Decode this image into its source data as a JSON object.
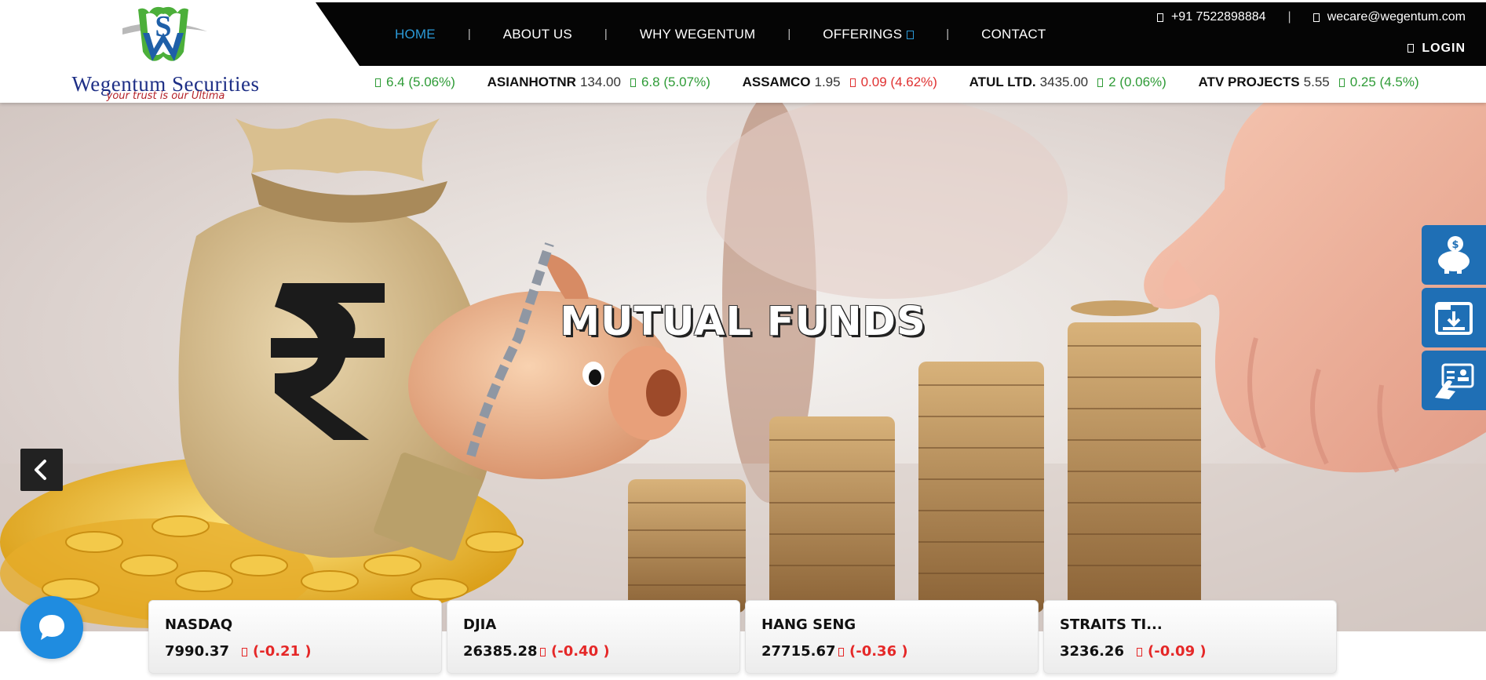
{
  "brand": {
    "name": "Wegentum Securities",
    "tagline": "your trust is our Ultima",
    "colors": {
      "navy": "#1e2f86",
      "accent": "#2b9ad8",
      "tagline": "#b5232a",
      "nav_bg": "#050505"
    }
  },
  "nav": {
    "items": [
      {
        "label": "HOME",
        "active": true
      },
      {
        "label": "ABOUT US"
      },
      {
        "label": "WHY WEGENTUM"
      },
      {
        "label": "OFFERINGS"
      },
      {
        "label": "CONTACT"
      }
    ],
    "separator": "|"
  },
  "topbar": {
    "phone": "+91 7522898884",
    "email": "wecare@wegentum.com",
    "login_label": "LOGIN"
  },
  "ticker": {
    "lead_change": "6.4 (5.06%)",
    "items": [
      {
        "symbol": "ASIANHOTNR",
        "price": "134.00",
        "change": "6.8 (5.07%)",
        "direction": "up"
      },
      {
        "symbol": "ASSAMCO",
        "price": "1.95",
        "change": "0.09 (4.62%)",
        "direction": "down"
      },
      {
        "symbol": "ATUL LTD.",
        "price": "3435.00",
        "change": "2 (0.06%)",
        "direction": "up"
      },
      {
        "symbol": "ATV PROJECTS",
        "price": "5.55",
        "change": "0.25 (4.5%)",
        "direction": "up"
      }
    ]
  },
  "hero": {
    "title": "MUTUAL FUNDS"
  },
  "side_tools": [
    {
      "icon": "piggy-bank-icon"
    },
    {
      "icon": "download-form-icon"
    },
    {
      "icon": "id-card-hand-icon"
    }
  ],
  "indices": [
    {
      "name": "NASDAQ",
      "value": "7990.37",
      "change": "(-0.21 )"
    },
    {
      "name": "DJIA",
      "value": "26385.28",
      "change": "(-0.40 )"
    },
    {
      "name": "HANG SENG",
      "value": "27715.67",
      "change": "(-0.36 )"
    },
    {
      "name": "STRAITS TI...",
      "value": "3236.26",
      "change": "(-0.09 )"
    }
  ],
  "chat": {
    "icon": "chat-bubble-icon"
  }
}
